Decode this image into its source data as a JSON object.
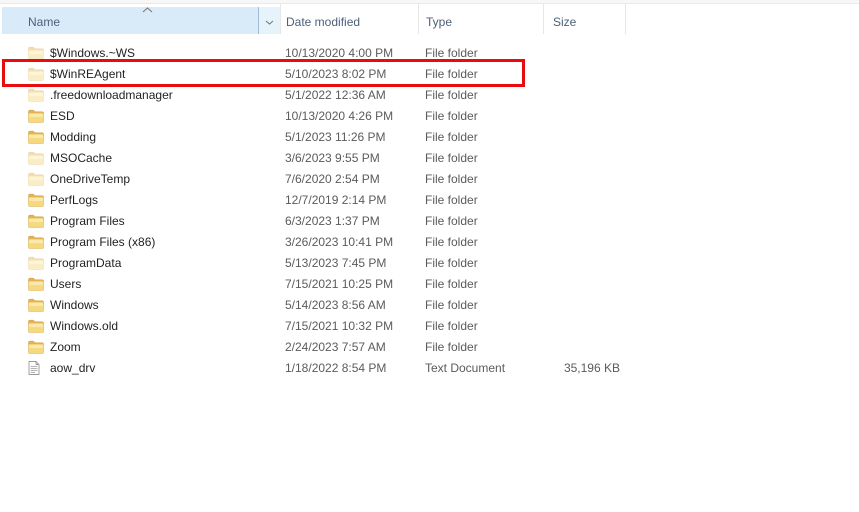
{
  "header": {
    "name_label": "Name",
    "date_label": "Date modified",
    "type_label": "Type",
    "size_label": "Size",
    "sorted_by": "Name",
    "sort_direction": "ascending"
  },
  "rows": [
    {
      "name": "$Windows.~WS",
      "date_modified": "10/13/2020 4:00 PM",
      "type": "File folder",
      "size": "",
      "icon": "folder",
      "hidden": true,
      "highlighted": false
    },
    {
      "name": "$WinREAgent",
      "date_modified": "5/10/2023 8:02 PM",
      "type": "File folder",
      "size": "",
      "icon": "folder",
      "hidden": true,
      "highlighted": true
    },
    {
      "name": ".freedownloadmanager",
      "date_modified": "5/1/2022 12:36 AM",
      "type": "File folder",
      "size": "",
      "icon": "folder",
      "hidden": true,
      "highlighted": false
    },
    {
      "name": "ESD",
      "date_modified": "10/13/2020 4:26 PM",
      "type": "File folder",
      "size": "",
      "icon": "folder",
      "hidden": false,
      "highlighted": false
    },
    {
      "name": "Modding",
      "date_modified": "5/1/2023 11:26 PM",
      "type": "File folder",
      "size": "",
      "icon": "folder",
      "hidden": false,
      "highlighted": false
    },
    {
      "name": "MSOCache",
      "date_modified": "3/6/2023 9:55 PM",
      "type": "File folder",
      "size": "",
      "icon": "folder",
      "hidden": true,
      "highlighted": false
    },
    {
      "name": "OneDriveTemp",
      "date_modified": "7/6/2020 2:54 PM",
      "type": "File folder",
      "size": "",
      "icon": "folder",
      "hidden": true,
      "highlighted": false
    },
    {
      "name": "PerfLogs",
      "date_modified": "12/7/2019 2:14 PM",
      "type": "File folder",
      "size": "",
      "icon": "folder",
      "hidden": false,
      "highlighted": false
    },
    {
      "name": "Program Files",
      "date_modified": "6/3/2023 1:37 PM",
      "type": "File folder",
      "size": "",
      "icon": "folder",
      "hidden": false,
      "highlighted": false
    },
    {
      "name": "Program Files (x86)",
      "date_modified": "3/26/2023 10:41 PM",
      "type": "File folder",
      "size": "",
      "icon": "folder",
      "hidden": false,
      "highlighted": false
    },
    {
      "name": "ProgramData",
      "date_modified": "5/13/2023 7:45 PM",
      "type": "File folder",
      "size": "",
      "icon": "folder",
      "hidden": true,
      "highlighted": false
    },
    {
      "name": "Users",
      "date_modified": "7/15/2021 10:25 PM",
      "type": "File folder",
      "size": "",
      "icon": "folder",
      "hidden": false,
      "highlighted": false
    },
    {
      "name": "Windows",
      "date_modified": "5/14/2023 8:56 AM",
      "type": "File folder",
      "size": "",
      "icon": "folder",
      "hidden": false,
      "highlighted": false
    },
    {
      "name": "Windows.old",
      "date_modified": "7/15/2021 10:32 PM",
      "type": "File folder",
      "size": "",
      "icon": "folder",
      "hidden": false,
      "highlighted": false
    },
    {
      "name": "Zoom",
      "date_modified": "2/24/2023 7:57 AM",
      "type": "File folder",
      "size": "",
      "icon": "folder",
      "hidden": false,
      "highlighted": false
    },
    {
      "name": "aow_drv",
      "date_modified": "1/18/2022 8:54 PM",
      "type": "Text Document",
      "size": "35,196 KB",
      "icon": "text-document",
      "hidden": false,
      "highlighted": false
    }
  ],
  "highlight": {
    "target_row": "$WinREAgent",
    "border_color": "#e80c0c"
  },
  "colors": {
    "header_hover_bg": "#d9ebf9",
    "header_filter_bg": "#e7f3fb",
    "header_text": "#4c607a",
    "row_text": "#211f1f",
    "secondary_text": "#5b5b5b",
    "separator": "#e7e7e7",
    "folder_yellow": "#f6d97f",
    "highlight_red": "#e80c0c"
  }
}
